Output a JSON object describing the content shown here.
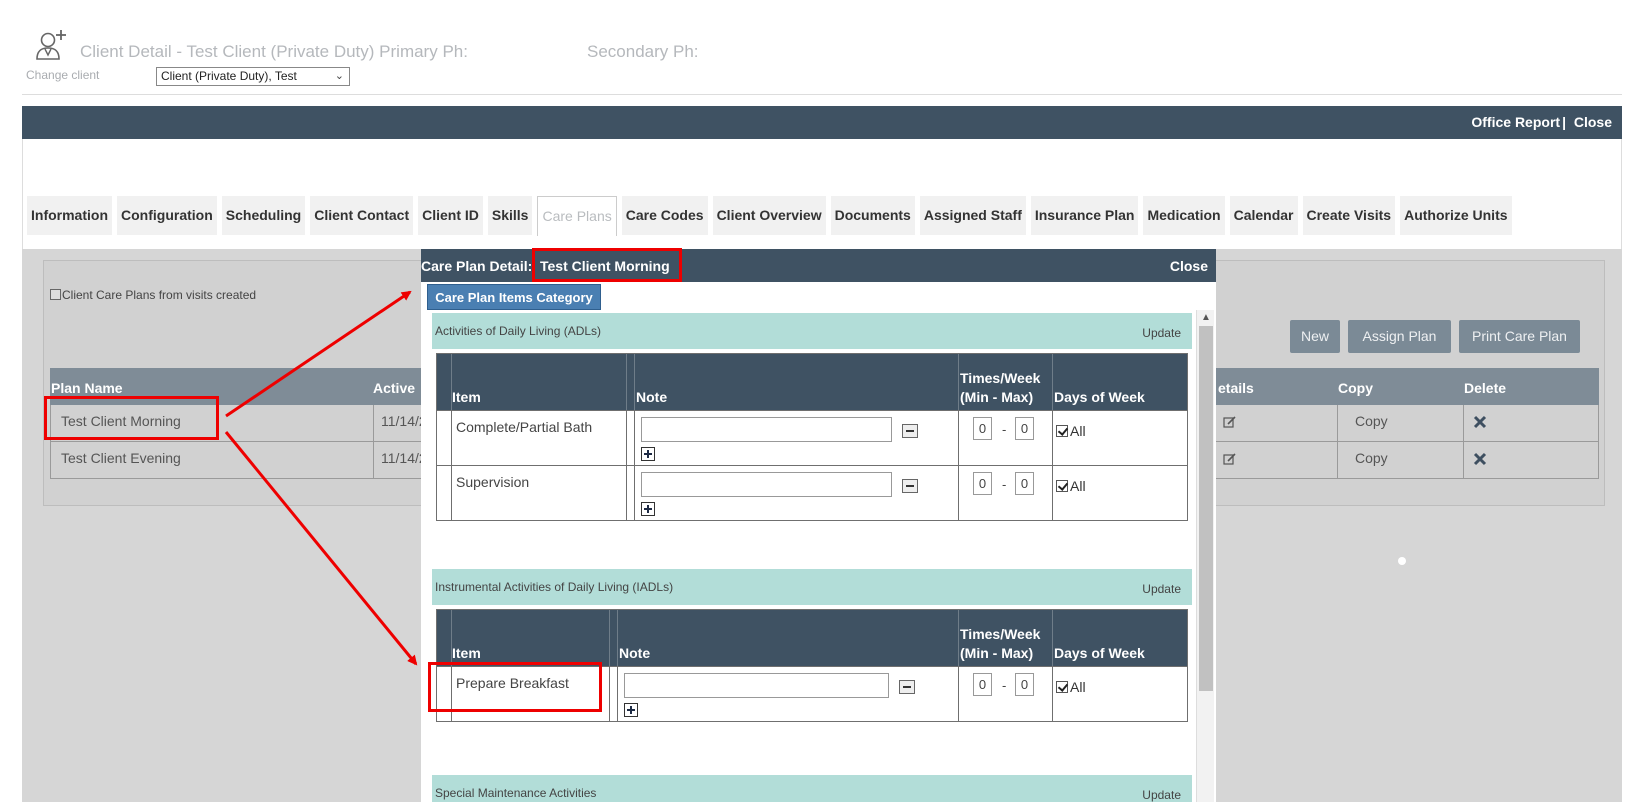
{
  "header": {
    "title": "Client Detail - Test Client (Private Duty) Primary Ph:",
    "secondary_label": "Secondary Ph:",
    "change_client_label": "Change client",
    "client_select_value": "Client (Private Duty), Test"
  },
  "topbar": {
    "office_report": "Office Report",
    "separator": "|",
    "close": "Close"
  },
  "tabs": [
    {
      "label": "Information"
    },
    {
      "label": "Configuration"
    },
    {
      "label": "Scheduling"
    },
    {
      "label": "Client Contact"
    },
    {
      "label": "Client ID"
    },
    {
      "label": "Skills"
    },
    {
      "label": "Care Plans",
      "active": true
    },
    {
      "label": "Care Codes"
    },
    {
      "label": "Client Overview"
    },
    {
      "label": "Documents"
    },
    {
      "label": "Assigned Staff"
    },
    {
      "label": "Insurance Plan"
    },
    {
      "label": "Medication"
    },
    {
      "label": "Calendar"
    },
    {
      "label": "Create Visits"
    },
    {
      "label": "Authorize Units"
    }
  ],
  "care_plans": {
    "checkbox_label": "Client Care Plans from visits created",
    "buttons": {
      "new": "New",
      "assign": "Assign Plan",
      "print": "Print Care Plan"
    },
    "columns": {
      "plan_name": "Plan Name",
      "active": "Active",
      "details": "etails",
      "copy": "Copy",
      "delete": "Delete"
    },
    "rows": [
      {
        "plan_name": "Test Client Morning",
        "active": "11/14/2",
        "copy": "Copy"
      },
      {
        "plan_name": "Test Client Evening",
        "active": "11/14/2",
        "copy": "Copy"
      }
    ]
  },
  "modal": {
    "title_prefix": "Care Plan Detail:",
    "title_plan": "Test Client Morning",
    "close": "Close",
    "category_button": "Care Plan Items Category",
    "columns": {
      "item": "Item",
      "note": "Note",
      "times_line1": "Times/Week",
      "times_line2": "(Min - Max)",
      "days": "Days of Week"
    },
    "sections": [
      {
        "name": "Activities of Daily Living (ADLs)",
        "update": "Update",
        "items": [
          {
            "item": "Complete/Partial Bath",
            "min": "0",
            "dash": "-",
            "max": "0",
            "days": "All"
          },
          {
            "item": "Supervision",
            "min": "0",
            "dash": "-",
            "max": "0",
            "days": "All"
          }
        ]
      },
      {
        "name": "Instrumental Activities of Daily Living (IADLs)",
        "update": "Update",
        "items": [
          {
            "item": "Prepare Breakfast",
            "min": "0",
            "dash": "-",
            "max": "0",
            "days": "All"
          }
        ]
      },
      {
        "name": "Special Maintenance Activities",
        "update": "Update"
      }
    ]
  },
  "colors": {
    "nav_dark": "#3f5263",
    "section_teal": "#b2ddd8",
    "category_blue": "#4a7fb2",
    "annotation_red": "#ee0000",
    "button_gray": "#7b8a96"
  }
}
